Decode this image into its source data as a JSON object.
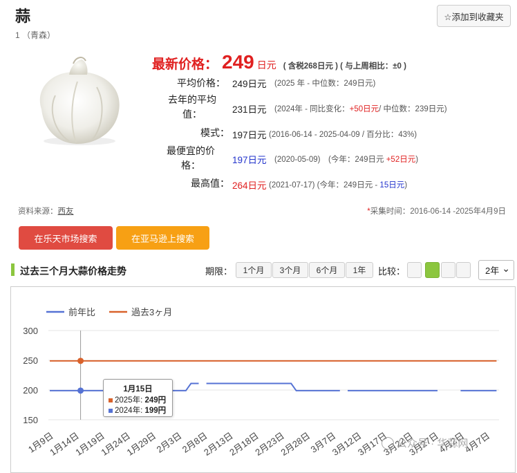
{
  "header": {
    "title": "蒜",
    "subtitle": "1 （青森）",
    "favorite_label": "☆添加到收藏夹"
  },
  "price": {
    "latest_label": "最新价格：",
    "latest_value": "249",
    "latest_unit": "日元",
    "latest_note": "( 含税268日元 ) ( 与上周相比：±0 )",
    "rows": [
      {
        "label": "平均价格：",
        "value": "249",
        "unit": "日元",
        "note": "(2025 年 - 中位数：249日元)"
      },
      {
        "label": "去年的平均值：",
        "value": "231",
        "unit": "日元",
        "note_prefix": "(2024年 - 同比变化：",
        "note_highlight": "+50日元",
        "note_suffix": "/ 中位数：239日元)"
      },
      {
        "label": "模式：",
        "value": "197",
        "unit": "日元",
        "note": "(2016-06-14 - 2025-04-09 / 百分比：43%)"
      },
      {
        "label": "最便宜的价格：",
        "value": "197",
        "unit": "日元",
        "note_prefix": "(2020-05-09)　(今年：249日元 ",
        "note_highlight": "+52日元",
        "note_suffix": ")"
      },
      {
        "label": "最高值：",
        "value": "264",
        "unit": "日元",
        "note_prefix": "(2021-07-17) (今年：249日元 - ",
        "note_highlight": "15日元",
        "note_suffix": ")"
      }
    ]
  },
  "source": {
    "label": "资料来源：",
    "link": "西友",
    "collect_star": "*",
    "collect_text": "采集时间：2016-06-14 -2025年4月9日"
  },
  "buttons": {
    "rakuten": "在乐天市场搜索",
    "amazon": "在亚马逊上搜索"
  },
  "chart_section": {
    "title": "过去三个月大蒜价格走势",
    "period_label": "期限：",
    "periods": [
      "1个月",
      "3个月",
      "6个月",
      "1年"
    ],
    "compare_label": "比较：",
    "compare_active_index": 1,
    "year_select": "2年",
    "year_arrow": "⌄"
  },
  "colors": {
    "prev_year": "#5572d4",
    "past3m": "#d9622b",
    "accent_green": "#8cc63f",
    "price_red": "#e02020"
  },
  "chart_data": {
    "type": "line",
    "legend": [
      "前年比",
      "過去3ヶ月"
    ],
    "ylim": [
      150,
      300
    ],
    "yticks": [
      150,
      200,
      250,
      300
    ],
    "xlabels": [
      "1月9日",
      "1月14日",
      "1月19日",
      "1月24日",
      "1月29日",
      "2月3日",
      "2月8日",
      "2月13日",
      "2月18日",
      "2月23日",
      "2月28日",
      "3月7日",
      "3月12日",
      "3月17日",
      "3月22日",
      "3月27日",
      "4月2日",
      "4月7日"
    ],
    "series": [
      {
        "name": "前年比",
        "segments": [
          [
            [
              0,
              199
            ],
            [
              5.3,
              199
            ],
            [
              5.5,
              211
            ],
            [
              5.8,
              211
            ]
          ],
          [
            [
              6.1,
              211
            ],
            [
              9.4,
              211
            ],
            [
              9.6,
              199
            ],
            [
              11.3,
              199
            ]
          ],
          [
            [
              11.6,
              199
            ],
            [
              15.1,
              199
            ]
          ],
          [
            [
              16.0,
              199
            ],
            [
              17.4,
              199
            ]
          ]
        ]
      },
      {
        "name": "過去3ヶ月",
        "segments": [
          [
            [
              0,
              249
            ],
            [
              17.4,
              249
            ]
          ]
        ]
      }
    ],
    "highlight_index": 1.2,
    "tooltip": {
      "date": "1月15日",
      "rows": [
        {
          "label": "2025年: ",
          "value": "249円"
        },
        {
          "label": "2024年: ",
          "value": "199円"
        }
      ]
    }
  },
  "watermark": "公众号 · 华蒜网"
}
